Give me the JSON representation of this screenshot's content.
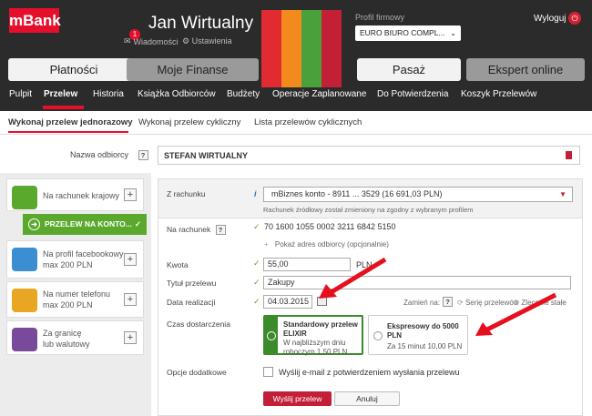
{
  "header": {
    "logo": "mBank",
    "user_name": "Jan Wirtualny",
    "messages_badge": "1",
    "messages_label": "Wiadomości",
    "settings_label": "Ustawienia",
    "profile_label": "Profil firmowy",
    "profile_value": "EURO BIURO COMPL...",
    "logout_label": "Wyloguj"
  },
  "main_nav": [
    {
      "label": "Płatności"
    },
    {
      "label": "Moje Finanse"
    },
    {
      "label": "Pasaż"
    },
    {
      "label": "Ekspert online"
    }
  ],
  "sub_nav": [
    "Pulpit",
    "Przelew",
    "Historia",
    "Książka Odbiorców",
    "Budżety",
    "Operacje Zaplanowane",
    "Do Potwierdzenia",
    "Koszyk Przelewów"
  ],
  "tabs": [
    "Wykonaj przelew jednorazowy",
    "Wykonaj przelew cykliczny",
    "Lista przelewów cyklicznych"
  ],
  "recipient": {
    "label": "Nazwa odbiorcy",
    "value": "STEFAN WIRTUALNY"
  },
  "sidebar": [
    {
      "label1": "Na rachunek krajowy",
      "label2": ""
    },
    {
      "label1": "Na profil facebookowy",
      "label2": "max 200 PLN"
    },
    {
      "label1": "Na numer telefonu",
      "label2": "max 200 PLN"
    },
    {
      "label1": "Za granicę",
      "label2": "lub walutowy"
    }
  ],
  "sidebar_active_button": "PRZELEW NA KONTO...",
  "form": {
    "from_label": "Z rachunku",
    "from_value": "mBiznes konto - 8911 ... 3529 (16 691,03 PLN)",
    "from_note": "Rachunek źródłowy został zmieniony na zgodny z wybranym profilem",
    "account_label": "Na rachunek",
    "account_value": "70 1600 1055 0002 3211 6842 5150",
    "show_address": "Pokaż adres odbiorcy (opcjonalnie)",
    "amount_label": "Kwota",
    "amount_value": "55,00",
    "amount_currency": "PLN",
    "title_label": "Tytuł przelewu",
    "title_value": "Zakupy",
    "date_label": "Data realizacji",
    "date_value": "04.03.2015",
    "change_to": "Zamień na:",
    "series_label": "Serię przelewów",
    "permanent_label": "Zlecenie stałe",
    "delivery_label": "Czas dostarczenia",
    "option_standard_title": "Standardowy przelew ELIXIR",
    "option_standard_desc": "W najbliższym dniu roboczym 1,50 PLN",
    "option_express_title": "Ekspresowy do 5000 PLN",
    "option_express_desc": "Za 15 minut 10,00 PLN",
    "extra_label": "Opcje dodatkowe",
    "email_option": "Wyślij e-mail z potwierdzeniem wysłania przelewu",
    "send_button": "Wyślij przelew",
    "cancel_button": "Anuluj"
  },
  "colors": {
    "brand": "#e60f2b",
    "green": "#5aa92d",
    "header_bg": "#2b2b2b",
    "stripe1": "#e22a32",
    "stripe2": "#f28a1e",
    "stripe3": "#4aa03a",
    "stripe4": "#c32038"
  }
}
